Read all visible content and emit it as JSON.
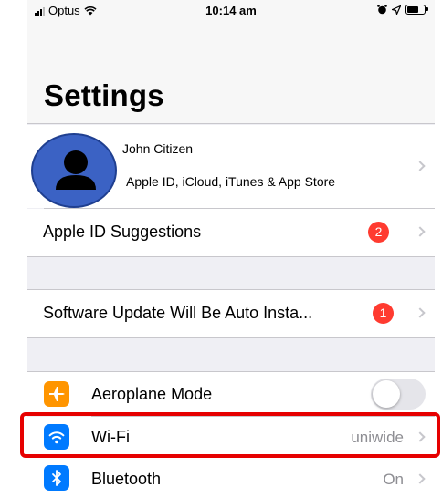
{
  "status_bar": {
    "carrier": "Optus",
    "time": "10:14 am"
  },
  "header": {
    "title": "Settings"
  },
  "profile": {
    "name": "John Citizen",
    "subtitle": "Apple ID, iCloud, iTunes & App Store"
  },
  "suggestions": {
    "label": "Apple ID Suggestions",
    "badge": "2"
  },
  "update": {
    "label": "Software Update Will Be Auto Insta...",
    "badge": "1"
  },
  "settings_items": [
    {
      "label": "Aeroplane Mode",
      "icon": "airplane-icon",
      "color": "#ff9500",
      "toggle_on": false
    },
    {
      "label": "Wi-Fi",
      "icon": "wifi-icon",
      "color": "#007aff",
      "detail": "uniwide"
    },
    {
      "label": "Bluetooth",
      "icon": "bluetooth-icon",
      "color": "#007aff",
      "detail": "On"
    }
  ],
  "colors": {
    "badge": "#ff3b30",
    "highlight": "#e60000",
    "group_bg": "#efeff4"
  }
}
